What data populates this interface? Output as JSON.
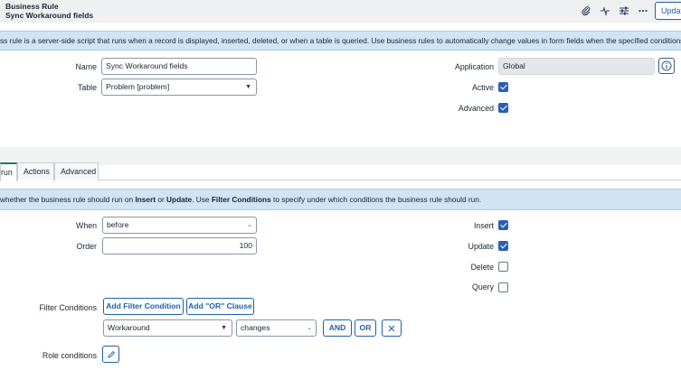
{
  "header": {
    "record_type": "Business Rule",
    "record_name": "Sync Workaround fields",
    "update_label": "Update",
    "icons": [
      "paperclip-icon",
      "activity-icon",
      "sliders-icon",
      "more-icon"
    ]
  },
  "banner_top": {
    "text": "ss rule is a server-side script that runs when a record is displayed, inserted, deleted, or when a table is queried. Use business rules to automatically change values in form fields when the specified conditions are m"
  },
  "form": {
    "name_label": "Name",
    "name_value": "Sync Workaround fields",
    "table_label": "Table",
    "table_value": "Problem [problem]",
    "application_label": "Application",
    "application_value": "Global",
    "active_label": "Active",
    "active_checked": true,
    "advanced_label": "Advanced",
    "advanced_checked": true
  },
  "tabs": [
    {
      "label": "run",
      "active": true
    },
    {
      "label": "Actions",
      "active": false
    },
    {
      "label": "Advanced",
      "active": false
    }
  ],
  "banner_when": {
    "part1": "whether the business rule should run on ",
    "insert": "Insert",
    "part2": " or ",
    "update": "Update",
    "part3": ". Use ",
    "filter": "Filter Conditions",
    "part4": " to specify under which conditions the business rule should run."
  },
  "when_section": {
    "when_label": "When",
    "when_value": "before",
    "order_label": "Order",
    "order_value": "100",
    "insert_label": "Insert",
    "insert_checked": true,
    "update_label": "Update",
    "update_checked": true,
    "delete_label": "Delete",
    "delete_checked": false,
    "query_label": "Query",
    "query_checked": false
  },
  "filter": {
    "label": "Filter Conditions",
    "add_condition": "Add Filter Condition",
    "add_or_clause": "Add \"OR\" Clause",
    "field_value": "Workaround",
    "operator_value": "changes",
    "and_label": "AND",
    "or_label": "OR",
    "remove_icon": "close-icon"
  },
  "role": {
    "label": "Role conditions",
    "edit_icon": "pencil-icon"
  }
}
